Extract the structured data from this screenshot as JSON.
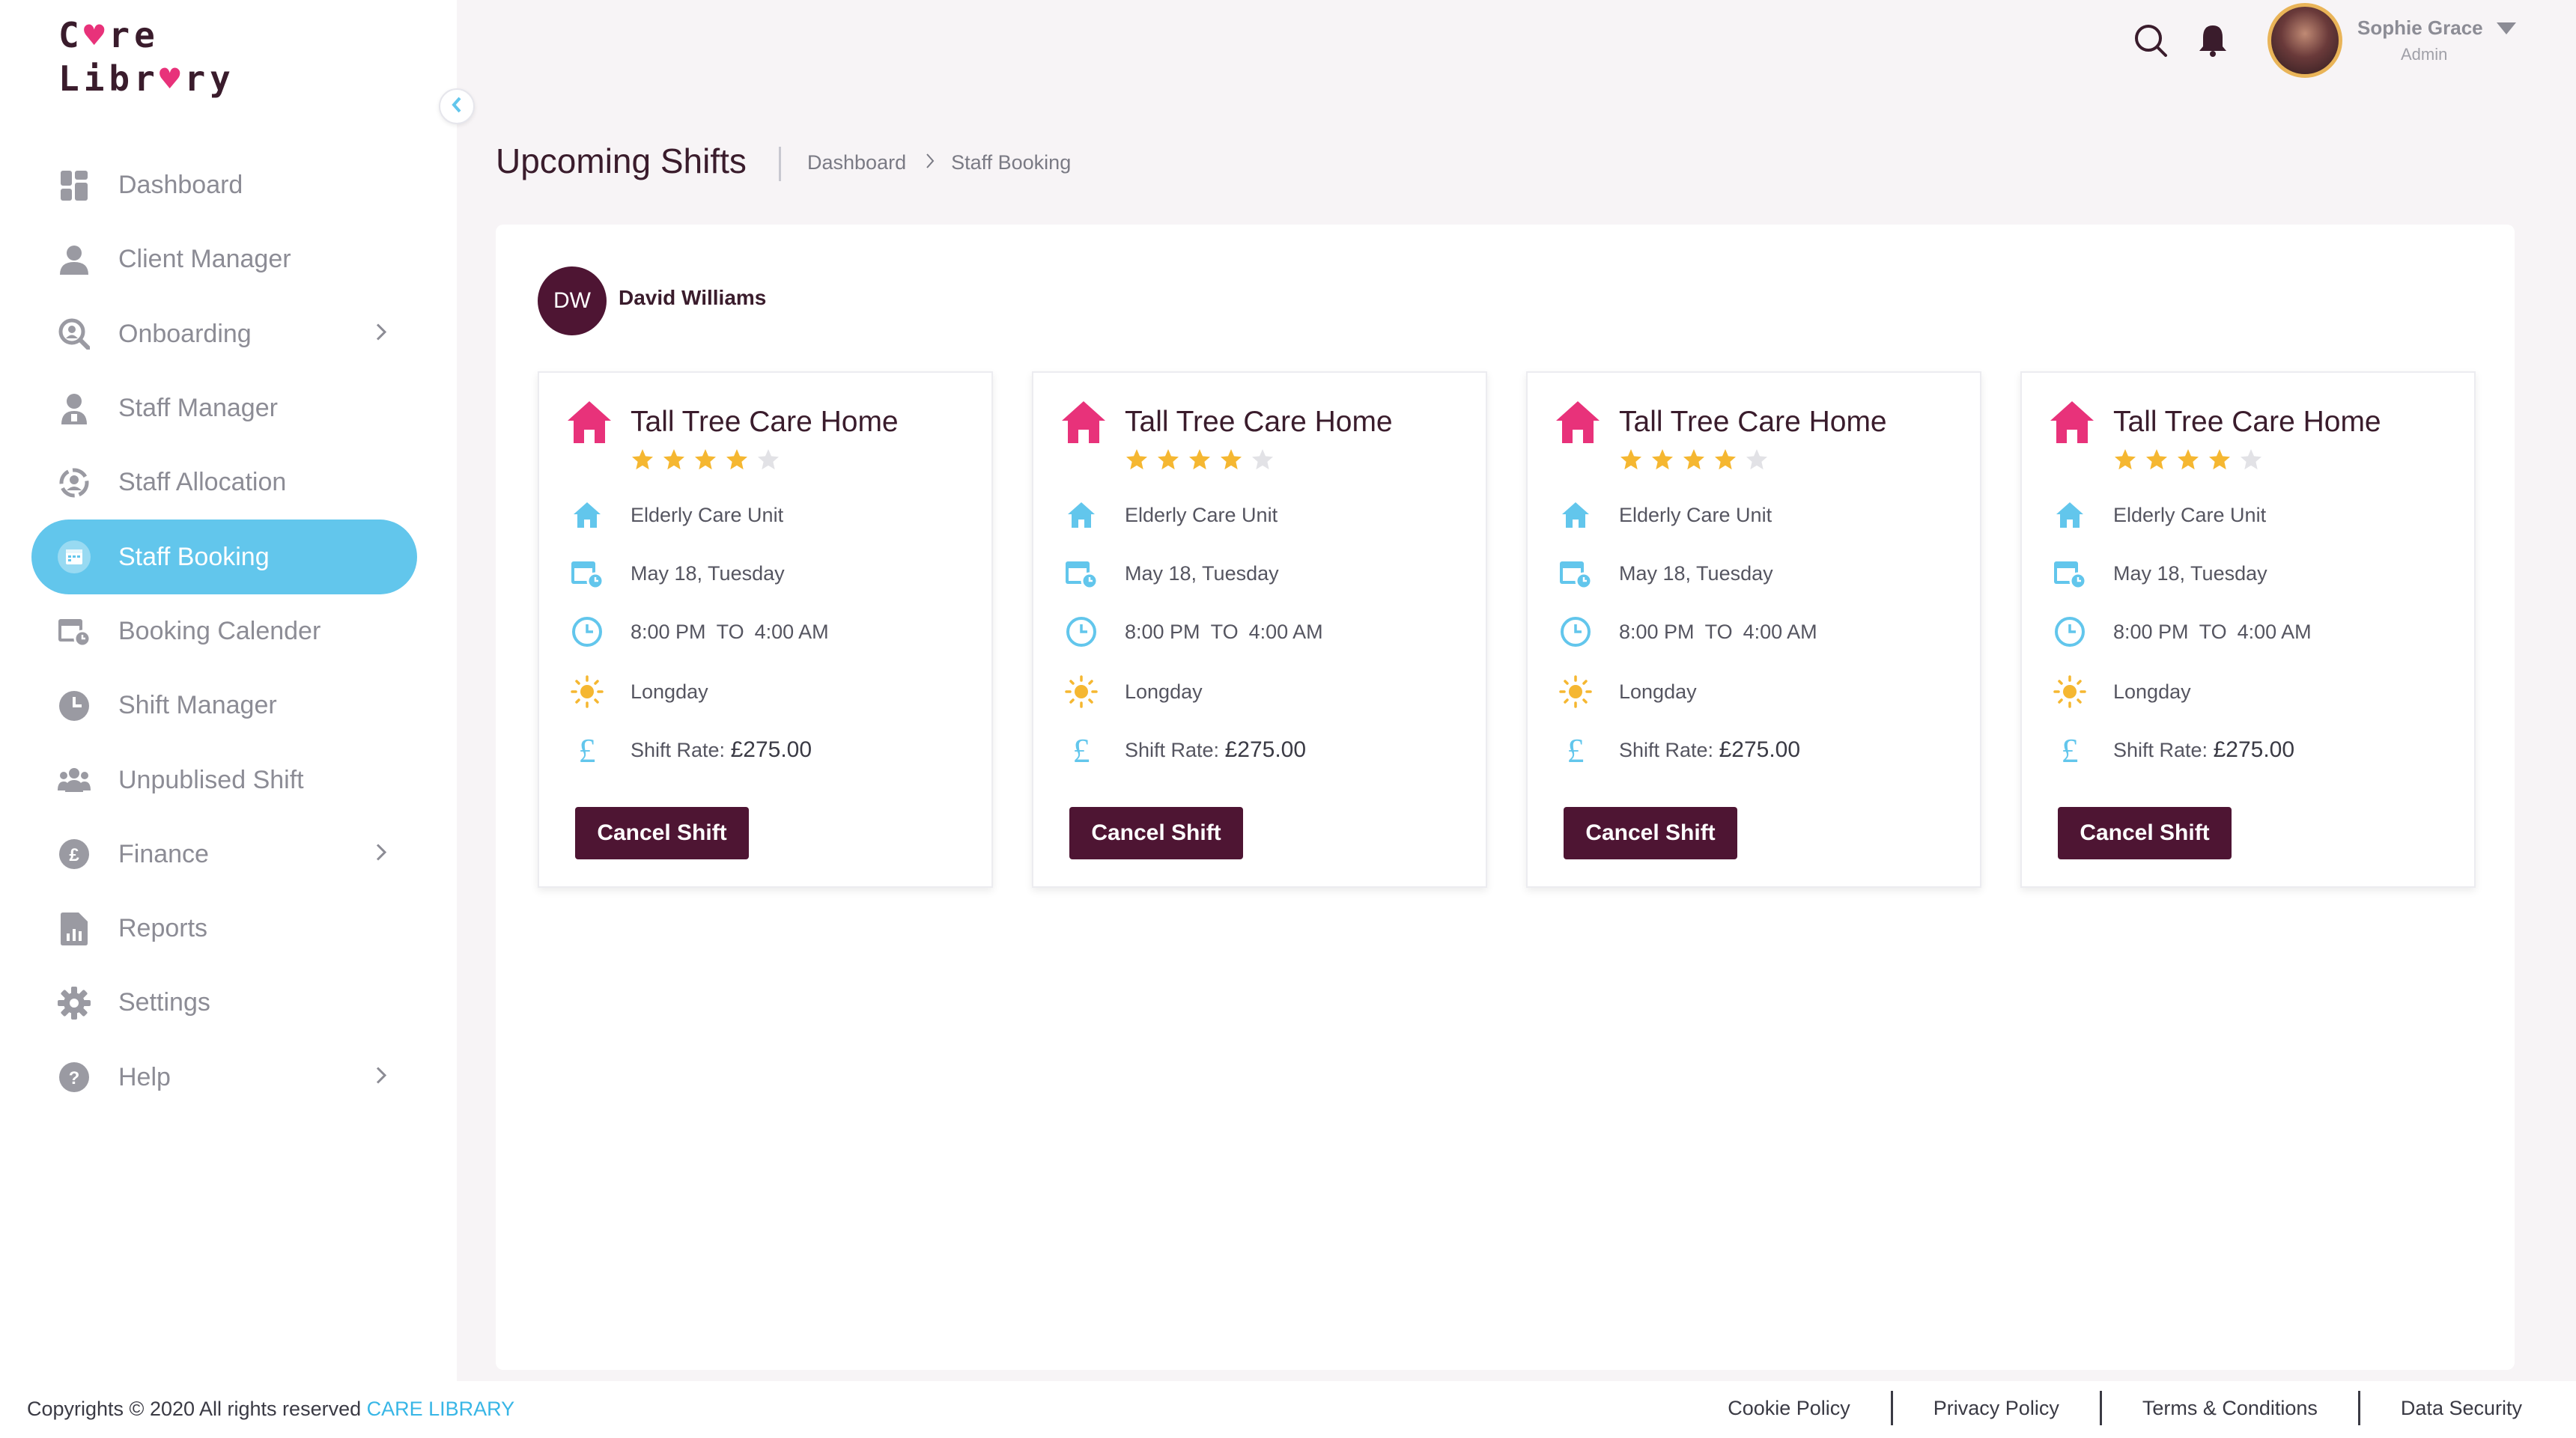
{
  "app": {
    "logo_line1_a": "C",
    "logo_line1_b": "re",
    "logo_line2_a": "Libr",
    "logo_line2_b": "ry"
  },
  "sidebar": {
    "items": [
      {
        "label": "Dashboard",
        "icon": "dashboard-icon"
      },
      {
        "label": "Client Manager",
        "icon": "user-icon"
      },
      {
        "label": "Onboarding",
        "icon": "onboarding-icon"
      },
      {
        "label": "Staff Manager",
        "icon": "staff-icon"
      },
      {
        "label": "Staff Allocation",
        "icon": "allocation-icon"
      },
      {
        "label": "Staff Booking",
        "icon": "calendar-icon",
        "active": true
      },
      {
        "label": "Booking Calender",
        "icon": "booking-calendar-icon"
      },
      {
        "label": "Shift Manager",
        "icon": "clock-icon"
      },
      {
        "label": "Unpublised Shift",
        "icon": "group-icon"
      },
      {
        "label": "Finance",
        "icon": "pound-icon"
      },
      {
        "label": "Reports",
        "icon": "report-icon"
      },
      {
        "label": "Settings",
        "icon": "gear-icon"
      },
      {
        "label": "Help",
        "icon": "help-icon"
      }
    ]
  },
  "header": {
    "user_name": "Sophie Grace",
    "user_role": "Admin"
  },
  "page": {
    "title": "Upcoming Shifts",
    "breadcrumb": [
      "Dashboard",
      "Staff Booking"
    ]
  },
  "staff": {
    "initials": "DW",
    "name": "David Williams"
  },
  "shifts": [
    {
      "home": "Tall Tree Care Home",
      "rating": 4,
      "unit": "Elderly Care Unit",
      "date": "May 18, Tuesday",
      "start": "8:00 PM",
      "to": "TO",
      "end": "4:00 AM",
      "type": "Longday",
      "rate_label": "Shift Rate:",
      "rate": "£275.00",
      "button": "Cancel Shift"
    },
    {
      "home": "Tall Tree Care Home",
      "rating": 4,
      "unit": "Elderly Care Unit",
      "date": "May 18, Tuesday",
      "start": "8:00 PM",
      "to": "TO",
      "end": "4:00 AM",
      "type": "Longday",
      "rate_label": "Shift Rate:",
      "rate": "£275.00",
      "button": "Cancel Shift"
    },
    {
      "home": "Tall Tree Care Home",
      "rating": 4,
      "unit": "Elderly Care Unit",
      "date": "May 18, Tuesday",
      "start": "8:00 PM",
      "to": "TO",
      "end": "4:00 AM",
      "type": "Longday",
      "rate_label": "Shift Rate:",
      "rate": "£275.00",
      "button": "Cancel Shift"
    },
    {
      "home": "Tall Tree Care Home",
      "rating": 4,
      "unit": "Elderly Care Unit",
      "date": "May 18, Tuesday",
      "start": "8:00 PM",
      "to": "TO",
      "end": "4:00 AM",
      "type": "Longday",
      "rate_label": "Shift Rate:",
      "rate": "£275.00",
      "button": "Cancel Shift"
    }
  ],
  "footer": {
    "copyright": "Copyrights © 2020  All rights reserved",
    "brand": "CARE LIBRARY",
    "links": [
      "Cookie Policy",
      "Privacy Policy",
      "Terms & Conditions",
      "Data Security"
    ]
  },
  "colors": {
    "accent": "#62c6ec",
    "primary": "#4e1533",
    "home_icon": "#e8327a",
    "star": "#f5b731",
    "star_empty": "#e2e2e6"
  }
}
